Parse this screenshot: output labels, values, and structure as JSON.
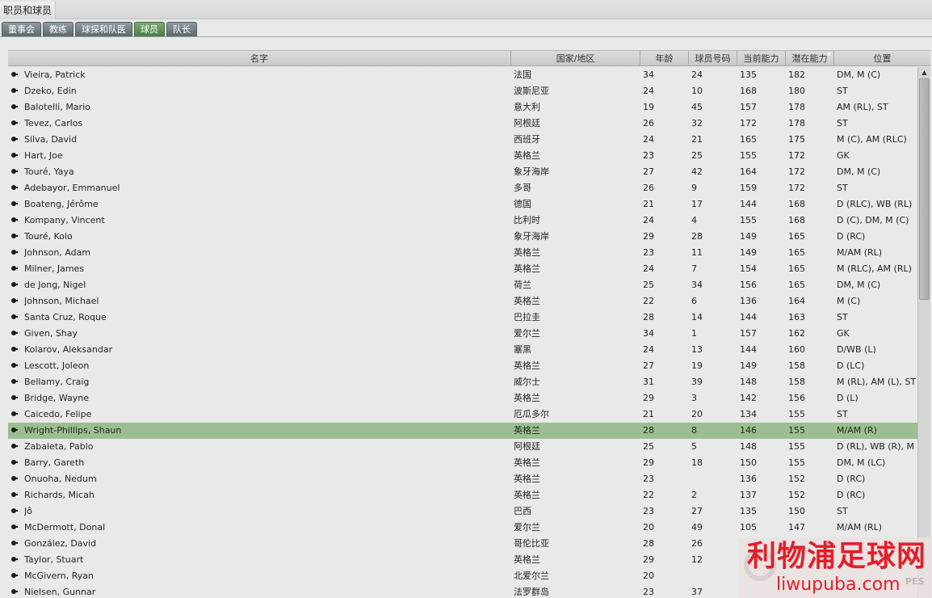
{
  "window": {
    "title": "职员和球员"
  },
  "tabs": [
    {
      "label": "董事会",
      "active": false
    },
    {
      "label": "教练",
      "active": false
    },
    {
      "label": "球探和队医",
      "active": false
    },
    {
      "label": "球员",
      "active": true
    },
    {
      "label": "队长",
      "active": false
    }
  ],
  "table": {
    "headers": {
      "name": "名字",
      "nation": "国家/地区",
      "age": "年龄",
      "number": "球员号码",
      "ca": "当前能力",
      "pa": "潜在能力",
      "position": "位置"
    },
    "sorted_column": "pa",
    "selected_row": 22,
    "rows": [
      {
        "name": "Vieira, Patrick",
        "nation": "法国",
        "age": "34",
        "number": "24",
        "ca": "135",
        "pa": "182",
        "position": "DM, M (C)"
      },
      {
        "name": "Dzeko, Edin",
        "nation": "波斯尼亚",
        "age": "24",
        "number": "10",
        "ca": "168",
        "pa": "180",
        "position": "ST"
      },
      {
        "name": "Balotelli, Mario",
        "nation": "意大利",
        "age": "19",
        "number": "45",
        "ca": "157",
        "pa": "178",
        "position": "AM (RL), ST"
      },
      {
        "name": "Tevez, Carlos",
        "nation": "阿根廷",
        "age": "26",
        "number": "32",
        "ca": "172",
        "pa": "178",
        "position": "ST"
      },
      {
        "name": "Silva, David",
        "nation": "西班牙",
        "age": "24",
        "number": "21",
        "ca": "165",
        "pa": "175",
        "position": "M (C), AM (RLC)"
      },
      {
        "name": "Hart, Joe",
        "nation": "英格兰",
        "age": "23",
        "number": "25",
        "ca": "155",
        "pa": "172",
        "position": "GK"
      },
      {
        "name": "Touré, Yaya",
        "nation": "象牙海岸",
        "age": "27",
        "number": "42",
        "ca": "164",
        "pa": "172",
        "position": "DM, M (C)"
      },
      {
        "name": "Adebayor, Emmanuel",
        "nation": "多哥",
        "age": "26",
        "number": "9",
        "ca": "159",
        "pa": "172",
        "position": "ST"
      },
      {
        "name": "Boateng, Jérôme",
        "nation": "德国",
        "age": "21",
        "number": "17",
        "ca": "144",
        "pa": "168",
        "position": "D (RLC), WB (RL)"
      },
      {
        "name": "Kompany, Vincent",
        "nation": "比利时",
        "age": "24",
        "number": "4",
        "ca": "155",
        "pa": "168",
        "position": "D (C), DM, M (C)"
      },
      {
        "name": "Touré, Kolo",
        "nation": "象牙海岸",
        "age": "29",
        "number": "28",
        "ca": "149",
        "pa": "165",
        "position": "D (RC)"
      },
      {
        "name": "Johnson, Adam",
        "nation": "英格兰",
        "age": "23",
        "number": "11",
        "ca": "149",
        "pa": "165",
        "position": "M/AM (RL)"
      },
      {
        "name": "Milner, James",
        "nation": "英格兰",
        "age": "24",
        "number": "7",
        "ca": "154",
        "pa": "165",
        "position": "M (RLC), AM (RL)"
      },
      {
        "name": "de Jong, Nigel",
        "nation": "荷兰",
        "age": "25",
        "number": "34",
        "ca": "156",
        "pa": "165",
        "position": "DM, M (C)"
      },
      {
        "name": "Johnson, Michael",
        "nation": "英格兰",
        "age": "22",
        "number": "6",
        "ca": "136",
        "pa": "164",
        "position": "M (C)"
      },
      {
        "name": "Santa Cruz, Roque",
        "nation": "巴拉圭",
        "age": "28",
        "number": "14",
        "ca": "144",
        "pa": "163",
        "position": "ST"
      },
      {
        "name": "Given, Shay",
        "nation": "爱尔兰",
        "age": "34",
        "number": "1",
        "ca": "157",
        "pa": "162",
        "position": "GK"
      },
      {
        "name": "Kolarov, Aleksandar",
        "nation": "塞黑",
        "age": "24",
        "number": "13",
        "ca": "144",
        "pa": "160",
        "position": "D/WB (L)"
      },
      {
        "name": "Lescott, Joleon",
        "nation": "英格兰",
        "age": "27",
        "number": "19",
        "ca": "149",
        "pa": "158",
        "position": "D (LC)"
      },
      {
        "name": "Bellamy, Craig",
        "nation": "威尔士",
        "age": "31",
        "number": "39",
        "ca": "148",
        "pa": "158",
        "position": "M (RL), AM (L), ST"
      },
      {
        "name": "Bridge, Wayne",
        "nation": "英格兰",
        "age": "29",
        "number": "3",
        "ca": "142",
        "pa": "156",
        "position": "D (L)"
      },
      {
        "name": "Caicedo, Felipe",
        "nation": "厄瓜多尔",
        "age": "21",
        "number": "20",
        "ca": "134",
        "pa": "155",
        "position": "ST"
      },
      {
        "name": "Wright-Phillips, Shaun",
        "nation": "英格兰",
        "age": "28",
        "number": "8",
        "ca": "146",
        "pa": "155",
        "position": "M/AM (R)"
      },
      {
        "name": "Zabaleta, Pablo",
        "nation": "阿根廷",
        "age": "25",
        "number": "5",
        "ca": "148",
        "pa": "155",
        "position": "D (RL), WB (R), M ."
      },
      {
        "name": "Barry, Gareth",
        "nation": "英格兰",
        "age": "29",
        "number": "18",
        "ca": "150",
        "pa": "155",
        "position": "DM, M (LC)"
      },
      {
        "name": "Onuoha, Nedum",
        "nation": "英格兰",
        "age": "23",
        "number": "",
        "ca": "136",
        "pa": "152",
        "position": "D (RC)"
      },
      {
        "name": "Richards, Micah",
        "nation": "英格兰",
        "age": "22",
        "number": "2",
        "ca": "137",
        "pa": "152",
        "position": "D (RC)"
      },
      {
        "name": "Jô",
        "nation": "巴西",
        "age": "23",
        "number": "27",
        "ca": "135",
        "pa": "150",
        "position": "ST"
      },
      {
        "name": "McDermott, Donal",
        "nation": "爱尔兰",
        "age": "20",
        "number": "49",
        "ca": "105",
        "pa": "147",
        "position": "M/AM (RL)"
      },
      {
        "name": "González, David",
        "nation": "哥伦比亚",
        "age": "28",
        "number": "26",
        "ca": "",
        "pa": "",
        "position": ""
      },
      {
        "name": "Taylor, Stuart",
        "nation": "英格兰",
        "age": "29",
        "number": "12",
        "ca": "",
        "pa": "",
        "position": ""
      },
      {
        "name": "McGivern, Ryan",
        "nation": "北爱尔兰",
        "age": "20",
        "number": "",
        "ca": "",
        "pa": "",
        "position": ""
      },
      {
        "name": "Nielsen, Gunnar",
        "nation": "法罗群岛",
        "age": "23",
        "number": "37",
        "ca": "",
        "pa": "",
        "position": ""
      }
    ]
  },
  "watermark": {
    "title": "利物浦足球网",
    "url": "liwupuba.com",
    "badge": "PES"
  },
  "colors": {
    "tab_inactive": "#6e797f",
    "tab_active": "#5f9156",
    "selected_row": "#9dbd92",
    "watermark_red": "#e0202a"
  }
}
